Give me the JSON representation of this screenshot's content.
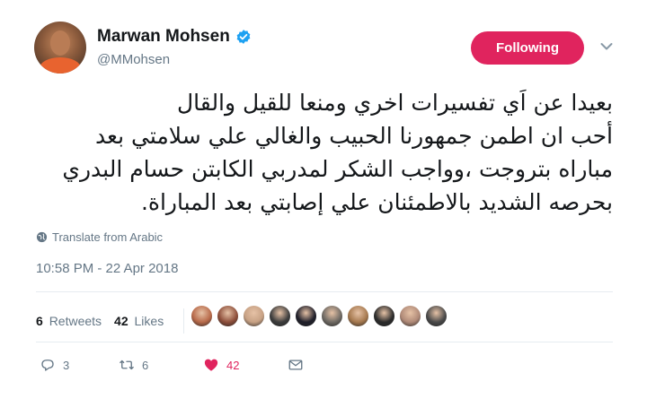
{
  "user": {
    "display_name": "Marwan Mohsen",
    "handle": "@MMohsen",
    "verified": true,
    "follow_button_label": "Following"
  },
  "tweet": {
    "text_lines": [
      "بعيدا عن اَي تفسيرات اخري ومنعا للقيل والقال",
      "أحب ان  اطمن جمهورنا الحبيب والغالي علي سلامتي  بعد",
      "مباراه بتروجت ،وواجب الشكر لمدربي الكابتن حسام البدري",
      "بحرصه الشديد بالاطمئنان  علي إصابتي بعد المباراة."
    ],
    "translate_label": "Translate from Arabic",
    "timestamp": "10:58 PM - 22 Apr 2018"
  },
  "stats": {
    "retweets_count": "6",
    "retweets_label": "Retweets",
    "likes_count": "42",
    "likes_label": "Likes"
  },
  "likers": [
    "#b86a4a",
    "#8e4f3b",
    "#c7a184",
    "#3d3d3d",
    "#1f1f2a",
    "#6f6a64",
    "#a6794f",
    "#2b2b2b",
    "#b08a78",
    "#4a4a4a"
  ],
  "actions": {
    "reply_count": "3",
    "retweet_count": "6",
    "like_count": "42"
  },
  "colors": {
    "accent_like": "#e0245e",
    "verified_blue": "#1da1f2",
    "muted_text": "#657786"
  },
  "icons": [
    "verified-badge-icon",
    "chevron-down-icon",
    "globe-icon",
    "reply-icon",
    "retweet-icon",
    "heart-icon",
    "direct-message-icon"
  ]
}
